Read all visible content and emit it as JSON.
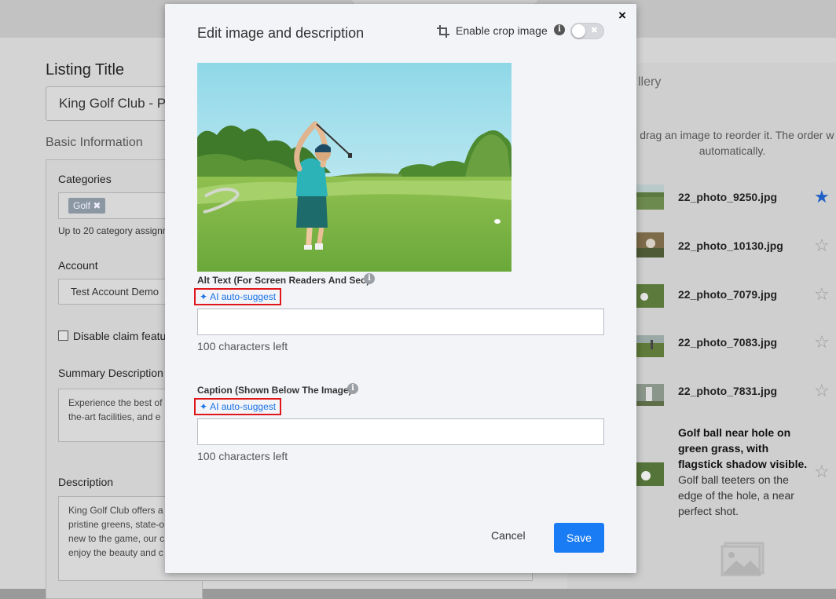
{
  "background": {
    "listing_title_label": "Listing Title",
    "listing_title_value": "King Golf Club - Pr",
    "basic_information": "Basic Information",
    "categories_label": "Categories",
    "category_tag": "Golf",
    "category_help": "Up to 20 category assignm",
    "account_label": "Account",
    "account_value": "Test Account Demo",
    "disable_claim_label": "Disable claim featu",
    "summary_label": "Summary Description",
    "summary_text": "Experience the best of\nthe-art facilities, and e",
    "description_label": "Description",
    "description_text": "King Golf Club offers a\npristine greens, state-o\nnew to the game, our c\nenjoy the beauty and c",
    "gallery_title": "llery",
    "gallery_help": "d drag an image to reorder it. The order w\nautomatically.",
    "gallery_items": [
      {
        "name": "22_photo_9250.jpg",
        "favorite": true
      },
      {
        "name": "22_photo_10130.jpg",
        "favorite": false
      },
      {
        "name": "22_photo_7079.jpg",
        "favorite": false
      },
      {
        "name": "22_photo_7083.jpg",
        "favorite": false
      },
      {
        "name": "22_photo_7831.jpg",
        "favorite": false
      }
    ],
    "gallery_caption_title": "Golf ball near hole on green grass, with flagstick shadow visible.",
    "gallery_caption_text": "Golf ball teeters on the edge of the hole, a near perfect shot."
  },
  "modal": {
    "title": "Edit image and description",
    "close": "×",
    "crop_label": "Enable crop image",
    "crop_enabled": false,
    "alt_text_label": "Alt Text (For Screen Readers And Seo)",
    "ai_suggest_label": "AI auto-suggest",
    "alt_text_value": "",
    "alt_chars_left": "100 characters left",
    "caption_label": "Caption (Shown Below The Image)",
    "caption_value": "",
    "caption_chars_left": "100 characters left",
    "cancel_label": "Cancel",
    "save_label": "Save"
  },
  "colors": {
    "primary": "#1a7cf5",
    "highlight_border": "#e0161c",
    "link": "#1a73e8"
  },
  "icons": [
    "crop-icon",
    "info-icon",
    "sparkle-icon",
    "close-icon",
    "star-icon",
    "image-placeholder-icon"
  ]
}
